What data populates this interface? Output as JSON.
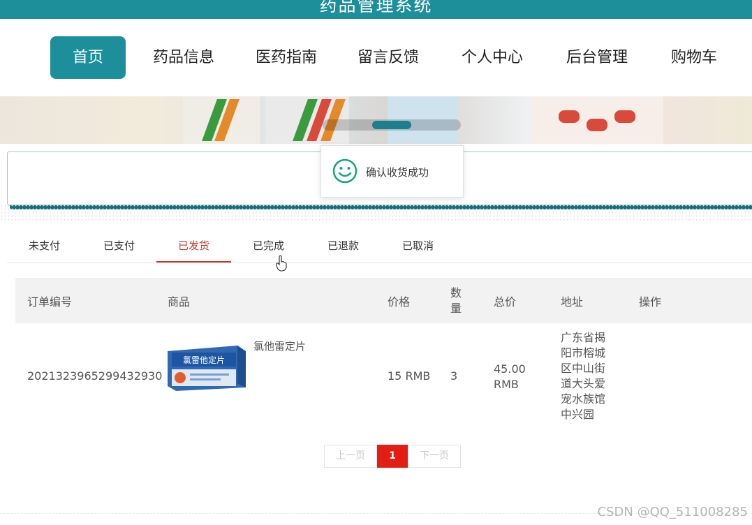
{
  "header": {
    "title": "药品管理系统"
  },
  "nav": {
    "items": [
      {
        "label": "首页",
        "active": true
      },
      {
        "label": "药品信息"
      },
      {
        "label": "医药指南"
      },
      {
        "label": "留言反馈"
      },
      {
        "label": "个人中心"
      },
      {
        "label": "后台管理"
      },
      {
        "label": "购物车"
      }
    ]
  },
  "toast": {
    "message": "确认收货成功",
    "icon": "smile-icon"
  },
  "tabs": [
    {
      "label": "未支付"
    },
    {
      "label": "已支付"
    },
    {
      "label": "已发货",
      "active": true
    },
    {
      "label": "已完成"
    },
    {
      "label": "已退款"
    },
    {
      "label": "已取消"
    }
  ],
  "table": {
    "headers": {
      "order_no": "订单编号",
      "product": "商品",
      "price": "价格",
      "qty": "数量",
      "total": "总价",
      "address": "地址",
      "action": "操作"
    },
    "rows": [
      {
        "order_no": "2021323965299432930",
        "product_name": "氯他雷定片",
        "product_image_text": "氯雷他定片",
        "price": "15 RMB",
        "qty": "3",
        "total": "45.00 RMB",
        "address": "广东省揭阳市榕城区中山街道大头爱宠水族馆中兴园"
      }
    ]
  },
  "pager": {
    "prev": "上一页",
    "current": "1",
    "next": "下一页"
  },
  "watermark": "CSDN @QQ_511008285",
  "colors": {
    "primary": "#1d8f9b",
    "active_tab": "#c0392b",
    "pager_current": "#e21e14"
  }
}
